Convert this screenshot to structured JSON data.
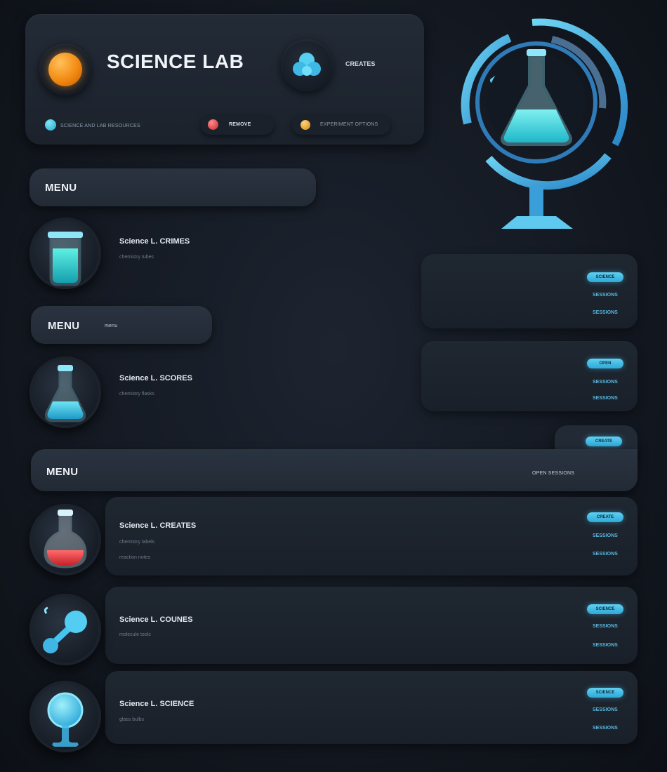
{
  "header": {
    "title": "SCIENCE LAB",
    "side_label": "CREATES",
    "chip_1": "SCIENCE AND LAB RESOURCES",
    "chip_2": "REMOVE",
    "chip_3": "EXPERIMENT OPTIONS"
  },
  "menus": [
    {
      "label": "MENU",
      "note": ""
    },
    {
      "label": "MENU",
      "note": "menu"
    },
    {
      "label": "MENU",
      "note": "OPEN SESSIONS"
    }
  ],
  "items": [
    {
      "title": "Science L. CRIMES",
      "sub": "chemistry tubes",
      "sub2": ""
    },
    {
      "title": "Science L. SCORES",
      "sub": "chemistry flasks",
      "sub2": ""
    },
    {
      "title": "Science L. CREATES",
      "sub": "chemistry labels",
      "sub2": "reaction notes"
    },
    {
      "title": "Science L. COUNES",
      "sub": "molecule tools",
      "sub2": ""
    },
    {
      "title": "Science L. SCIENCE",
      "sub": "glass bulbs",
      "sub2": ""
    }
  ],
  "right_cards": [
    {
      "badge": "SCIENCE",
      "link1": "SESSIONS",
      "link2": "SESSIONS"
    },
    {
      "badge": "OPEN",
      "link1": "SESSIONS",
      "link2": "SESSIONS"
    },
    {
      "badge": "CREATE",
      "link1": "",
      "link2": ""
    },
    {
      "badge": "CREATE",
      "link1": "SESSIONS",
      "link2": "SESSIONS"
    },
    {
      "badge": "SCIENCE",
      "link1": "SESSIONS",
      "link2": "SESSIONS"
    },
    {
      "badge": "SCIENCE",
      "link1": "SESSIONS",
      "link2": "SESSIONS"
    }
  ],
  "colors": {
    "accent": "#4fc3ec",
    "liquid_teal": "#2ec4c9",
    "liquid_red": "#e23b3b",
    "orange": "#f28a12"
  }
}
